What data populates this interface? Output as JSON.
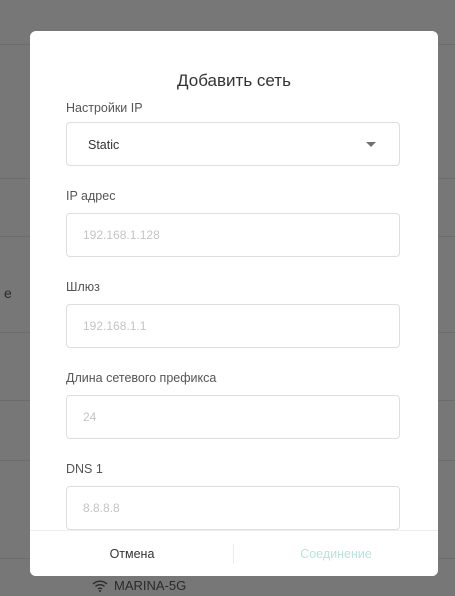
{
  "background": {
    "side_text": "е",
    "wifi_network": "MARINA-5G"
  },
  "dialog": {
    "title": "Добавить сеть",
    "ip_settings": {
      "label": "Настройки IP",
      "value": "Static"
    },
    "ip_address": {
      "label": "IP адрес",
      "placeholder": "192.168.1.128"
    },
    "gateway": {
      "label": "Шлюз",
      "placeholder": "192.168.1.1"
    },
    "prefix_length": {
      "label": "Длина сетевого префикса",
      "placeholder": "24"
    },
    "dns1": {
      "label": "DNS 1",
      "placeholder": "8.8.8.8"
    },
    "cancel_label": "Отмена",
    "connect_label": "Соединение"
  },
  "colors": {
    "accent_disabled": "#b8e3e0",
    "overlay": "#777777"
  },
  "icons": {
    "dropdown": "caret-down-icon",
    "wifi": "wifi-icon"
  }
}
